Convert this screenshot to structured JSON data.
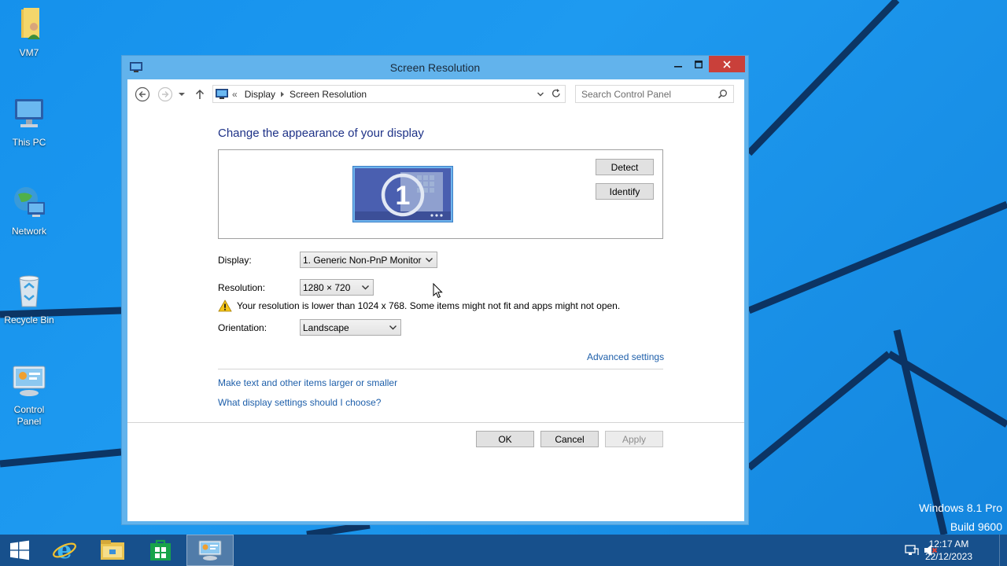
{
  "desktop": {
    "icons": [
      {
        "label": "VM7",
        "icon": "folder-user-icon"
      },
      {
        "label": "This PC",
        "icon": "computer-icon"
      },
      {
        "label": "Network",
        "icon": "network-globe-icon"
      },
      {
        "label": "Recycle Bin",
        "icon": "recycle-bin-icon"
      },
      {
        "label": "Control\nPanel",
        "icon": "control-panel-icon"
      }
    ],
    "watermark": {
      "line1": "Windows 8.1 Pro",
      "line2": "Build 9600"
    }
  },
  "window": {
    "title": "Screen Resolution",
    "address": {
      "prefix": "«",
      "crumb1": "Display",
      "crumb2": "Screen Resolution"
    },
    "search": {
      "placeholder": "Search Control Panel"
    },
    "heading": "Change the appearance of your display",
    "monitor_number": "1",
    "buttons": {
      "detect": "Detect",
      "identify": "Identify",
      "ok": "OK",
      "cancel": "Cancel",
      "apply": "Apply"
    },
    "fields": {
      "display_label": "Display:",
      "display_value": "1. Generic Non-PnP Monitor",
      "resolution_label": "Resolution:",
      "resolution_value": "1280 × 720",
      "orientation_label": "Orientation:",
      "orientation_value": "Landscape"
    },
    "warning": "Your resolution is lower than 1024 x 768. Some items might not fit and apps might not open.",
    "links": {
      "advanced": "Advanced settings",
      "text_size": "Make text and other items larger or smaller",
      "help": "What display settings should I choose?"
    }
  },
  "taskbar": {
    "items": [
      "start-icon",
      "internet-explorer-icon",
      "file-explorer-icon",
      "store-icon",
      "control-panel-icon"
    ],
    "clock": {
      "time": "12:17 AM",
      "date": "22/12/2023"
    }
  },
  "colors": {
    "accent": "#62b3ec",
    "close": "#c9403a",
    "link": "#1e5faa",
    "heading": "#1e3287",
    "taskbar": "#17508c"
  }
}
